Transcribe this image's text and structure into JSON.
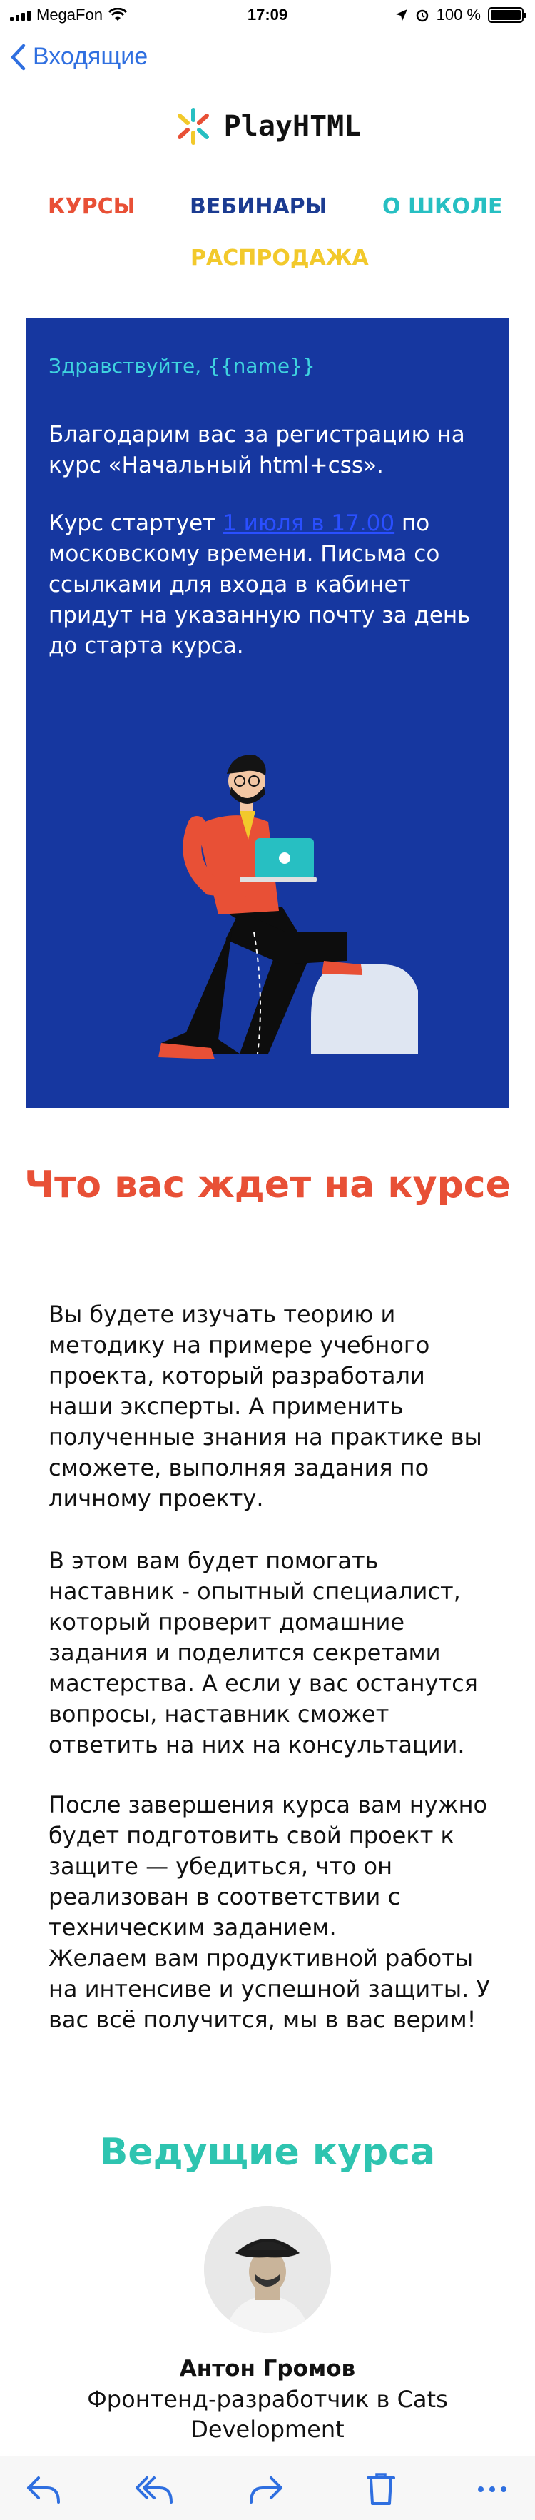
{
  "status_bar": {
    "carrier": "MegaFon",
    "time": "17:09",
    "battery": "100 %"
  },
  "nav": {
    "back_label": "Входящие"
  },
  "header": {
    "logo_text": "PlayHTML",
    "menu": [
      {
        "label": "КУРСЫ",
        "color": "#e85036"
      },
      {
        "label": "ВЕБИНАРЫ",
        "color": "#1b3b91"
      },
      {
        "label": "О ШКОЛЕ",
        "color": "#27bfc2"
      },
      {
        "label": "РАСПРОДАЖА",
        "color": "#f2c92b"
      }
    ]
  },
  "hero": {
    "greeting": "Здравствуйте, {{name}}",
    "intro": "Благодарим вас за регистрацию на курс «Начальный html+css».",
    "start_prefix": "Курс стартует ",
    "start_date_link": "1 июля в 17.00",
    "start_suffix": " по московскому времени. Письма со ссылками для входа в кабинет придут на указанную почту за день до старта курса.",
    "background": "#1637a0"
  },
  "course": {
    "title": "Что вас ждет на курсе",
    "paragraphs": [
      "Вы будете изучать теорию и методику на примере учебного проекта, который разработали наши эксперты. А применить полученные знания на практике вы сможете, выполняя задания по личному проекту.",
      "В этом вам будет помогать наставник - опытный специалист, который проверит домашние задания и поделится секретами мастерства. А если у вас останутся вопросы, наставник сможет ответить на них на консультации.",
      "После завершения курса вам нужно будет подготовить свой проект к защите — убедиться, что он реализован в соответствии с техническим заданием.",
      "Желаем вам продуктивной работы на интенсиве и успешной защиты. У вас всё получится, мы в вас верим!"
    ]
  },
  "tutors": {
    "title": "Ведущие курса",
    "items": [
      {
        "name": "Антон Громов",
        "role": "Фронтенд-разработчик в Cats Development"
      }
    ]
  },
  "toolbar": {
    "icons": [
      "reply-icon",
      "reply-all-icon",
      "forward-icon",
      "trash-icon",
      "more-icon"
    ]
  },
  "colors": {
    "accent_red": "#e85036",
    "accent_blue": "#1b3b91",
    "accent_teal": "#27bfc2",
    "accent_yellow": "#f2c92b",
    "ios_blue": "#2f6fe0"
  }
}
